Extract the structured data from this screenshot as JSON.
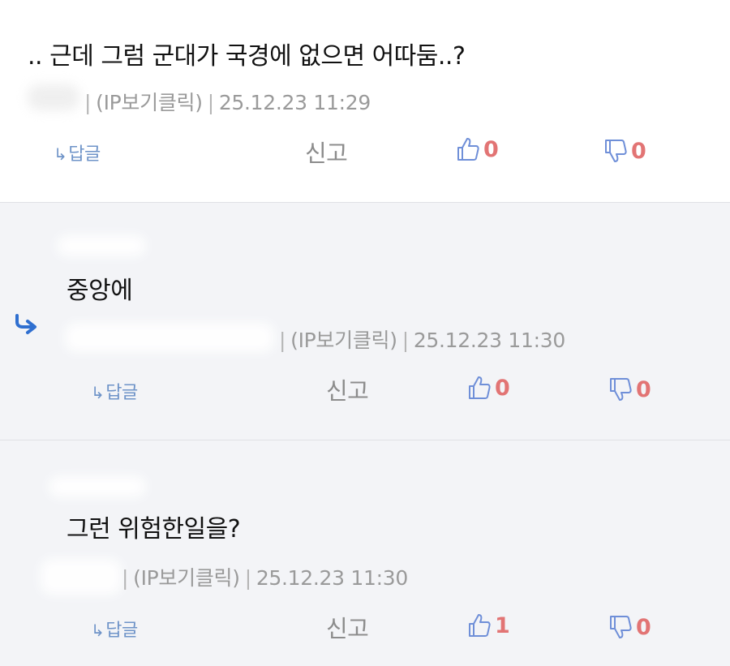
{
  "comments": [
    {
      "body": ".. 근데 그럼 군대가 국경에 없으면 어따둠..?",
      "ip_label": "(IP보기클릭)",
      "timestamp": "25.12.23 11:29",
      "reply_label": "답글",
      "report_label": "신고",
      "likes": "0",
      "dislikes": "0"
    },
    {
      "body": "중앙에",
      "ip_label": "(IP보기클릭)",
      "timestamp": "25.12.23 11:30",
      "reply_label": "답글",
      "report_label": "신고",
      "likes": "0",
      "dislikes": "0"
    },
    {
      "body": "그런 위험한일을?",
      "ip_label": "(IP보기클릭)",
      "timestamp": "25.12.23 11:30",
      "reply_label": "답글",
      "report_label": "신고",
      "likes": "1",
      "dislikes": "0"
    }
  ],
  "colors": {
    "reply_blue": "#6e93c8",
    "indent_arrow_blue": "#2f6fd0",
    "vote_count_red": "#e27474",
    "thumb_outline_blue": "#6f8fd8",
    "reply_bg": "#f3f4f7"
  },
  "icons": {
    "reply": "reply-arrow-icon",
    "indent": "indent-reply-arrow-icon",
    "like": "thumbs-up-icon",
    "dislike": "thumbs-down-icon"
  }
}
